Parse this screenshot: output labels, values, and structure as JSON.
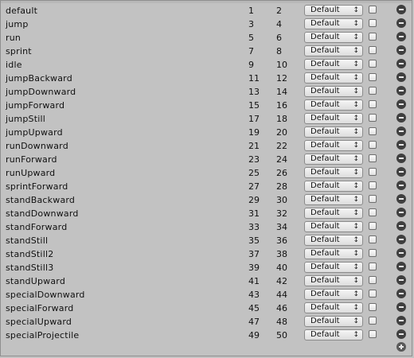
{
  "rows": [
    {
      "name": "default",
      "a": "1",
      "b": "2",
      "mode": "Default"
    },
    {
      "name": "jump",
      "a": "3",
      "b": "4",
      "mode": "Default"
    },
    {
      "name": "run",
      "a": "5",
      "b": "6",
      "mode": "Default"
    },
    {
      "name": "sprint",
      "a": "7",
      "b": "8",
      "mode": "Default"
    },
    {
      "name": "idle",
      "a": "9",
      "b": "10",
      "mode": "Default"
    },
    {
      "name": "jumpBackward",
      "a": "11",
      "b": "12",
      "mode": "Default"
    },
    {
      "name": "jumpDownward",
      "a": "13",
      "b": "14",
      "mode": "Default"
    },
    {
      "name": "jumpForward",
      "a": "15",
      "b": "16",
      "mode": "Default"
    },
    {
      "name": "jumpStill",
      "a": "17",
      "b": "18",
      "mode": "Default"
    },
    {
      "name": "jumpUpward",
      "a": "19",
      "b": "20",
      "mode": "Default"
    },
    {
      "name": "runDownward",
      "a": "21",
      "b": "22",
      "mode": "Default"
    },
    {
      "name": "runForward",
      "a": "23",
      "b": "24",
      "mode": "Default"
    },
    {
      "name": "runUpward",
      "a": "25",
      "b": "26",
      "mode": "Default"
    },
    {
      "name": "sprintForward",
      "a": "27",
      "b": "28",
      "mode": "Default"
    },
    {
      "name": "standBackward",
      "a": "29",
      "b": "30",
      "mode": "Default"
    },
    {
      "name": "standDownward",
      "a": "31",
      "b": "32",
      "mode": "Default"
    },
    {
      "name": "standForward",
      "a": "33",
      "b": "34",
      "mode": "Default"
    },
    {
      "name": "standStill",
      "a": "35",
      "b": "36",
      "mode": "Default"
    },
    {
      "name": "standStill2",
      "a": "37",
      "b": "38",
      "mode": "Default"
    },
    {
      "name": "standStill3",
      "a": "39",
      "b": "40",
      "mode": "Default"
    },
    {
      "name": "standUpward",
      "a": "41",
      "b": "42",
      "mode": "Default"
    },
    {
      "name": "specialDownward",
      "a": "43",
      "b": "44",
      "mode": "Default"
    },
    {
      "name": "specialForward",
      "a": "45",
      "b": "46",
      "mode": "Default"
    },
    {
      "name": "specialUpward",
      "a": "47",
      "b": "48",
      "mode": "Default"
    },
    {
      "name": "specialProjectile",
      "a": "49",
      "b": "50",
      "mode": "Default"
    }
  ],
  "icons": {
    "dropdown": "updown-arrows-icon",
    "remove": "minus-circle-icon",
    "add": "plus-circle-icon",
    "toggle": "checkbox-icon"
  },
  "colors": {
    "panel_bg": "#c2c2c2",
    "remove_icon": "#3f3f3f"
  }
}
